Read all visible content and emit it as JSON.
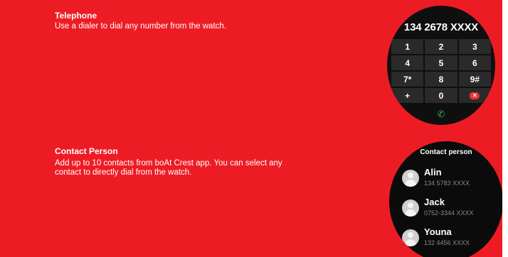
{
  "sections": [
    {
      "title": "Telephone",
      "description": "Use a dialer to dial any number from the watch."
    },
    {
      "title": "Contact Person",
      "description_lines": [
        "Add up to 10 contacts from boAt Crest app. You can select any",
        "contact to directly dial from the watch."
      ]
    }
  ],
  "dialer": {
    "display_number": "134 2678 XXXX",
    "keys": [
      "1",
      "2",
      "3",
      "4",
      "5",
      "6",
      "7*",
      "8",
      "9#",
      "+",
      "0"
    ],
    "delete_icon": "backspace-x-icon",
    "call_icon": "phone-icon",
    "call_icon_color": "#2fb24a"
  },
  "contacts_screen": {
    "title": "Contact person",
    "contacts": [
      {
        "name": "Alin",
        "number": "134 5783 XXXX"
      },
      {
        "name": "Jack",
        "number": "0752-3344 XXXX"
      },
      {
        "name": "Youna",
        "number": "132 4456 XXXX"
      }
    ],
    "avatar_icon": "user-avatar-icon"
  },
  "colors": {
    "background": "#ed1c24",
    "screen": "#0f0f0f",
    "accent_red": "#e8332f"
  }
}
